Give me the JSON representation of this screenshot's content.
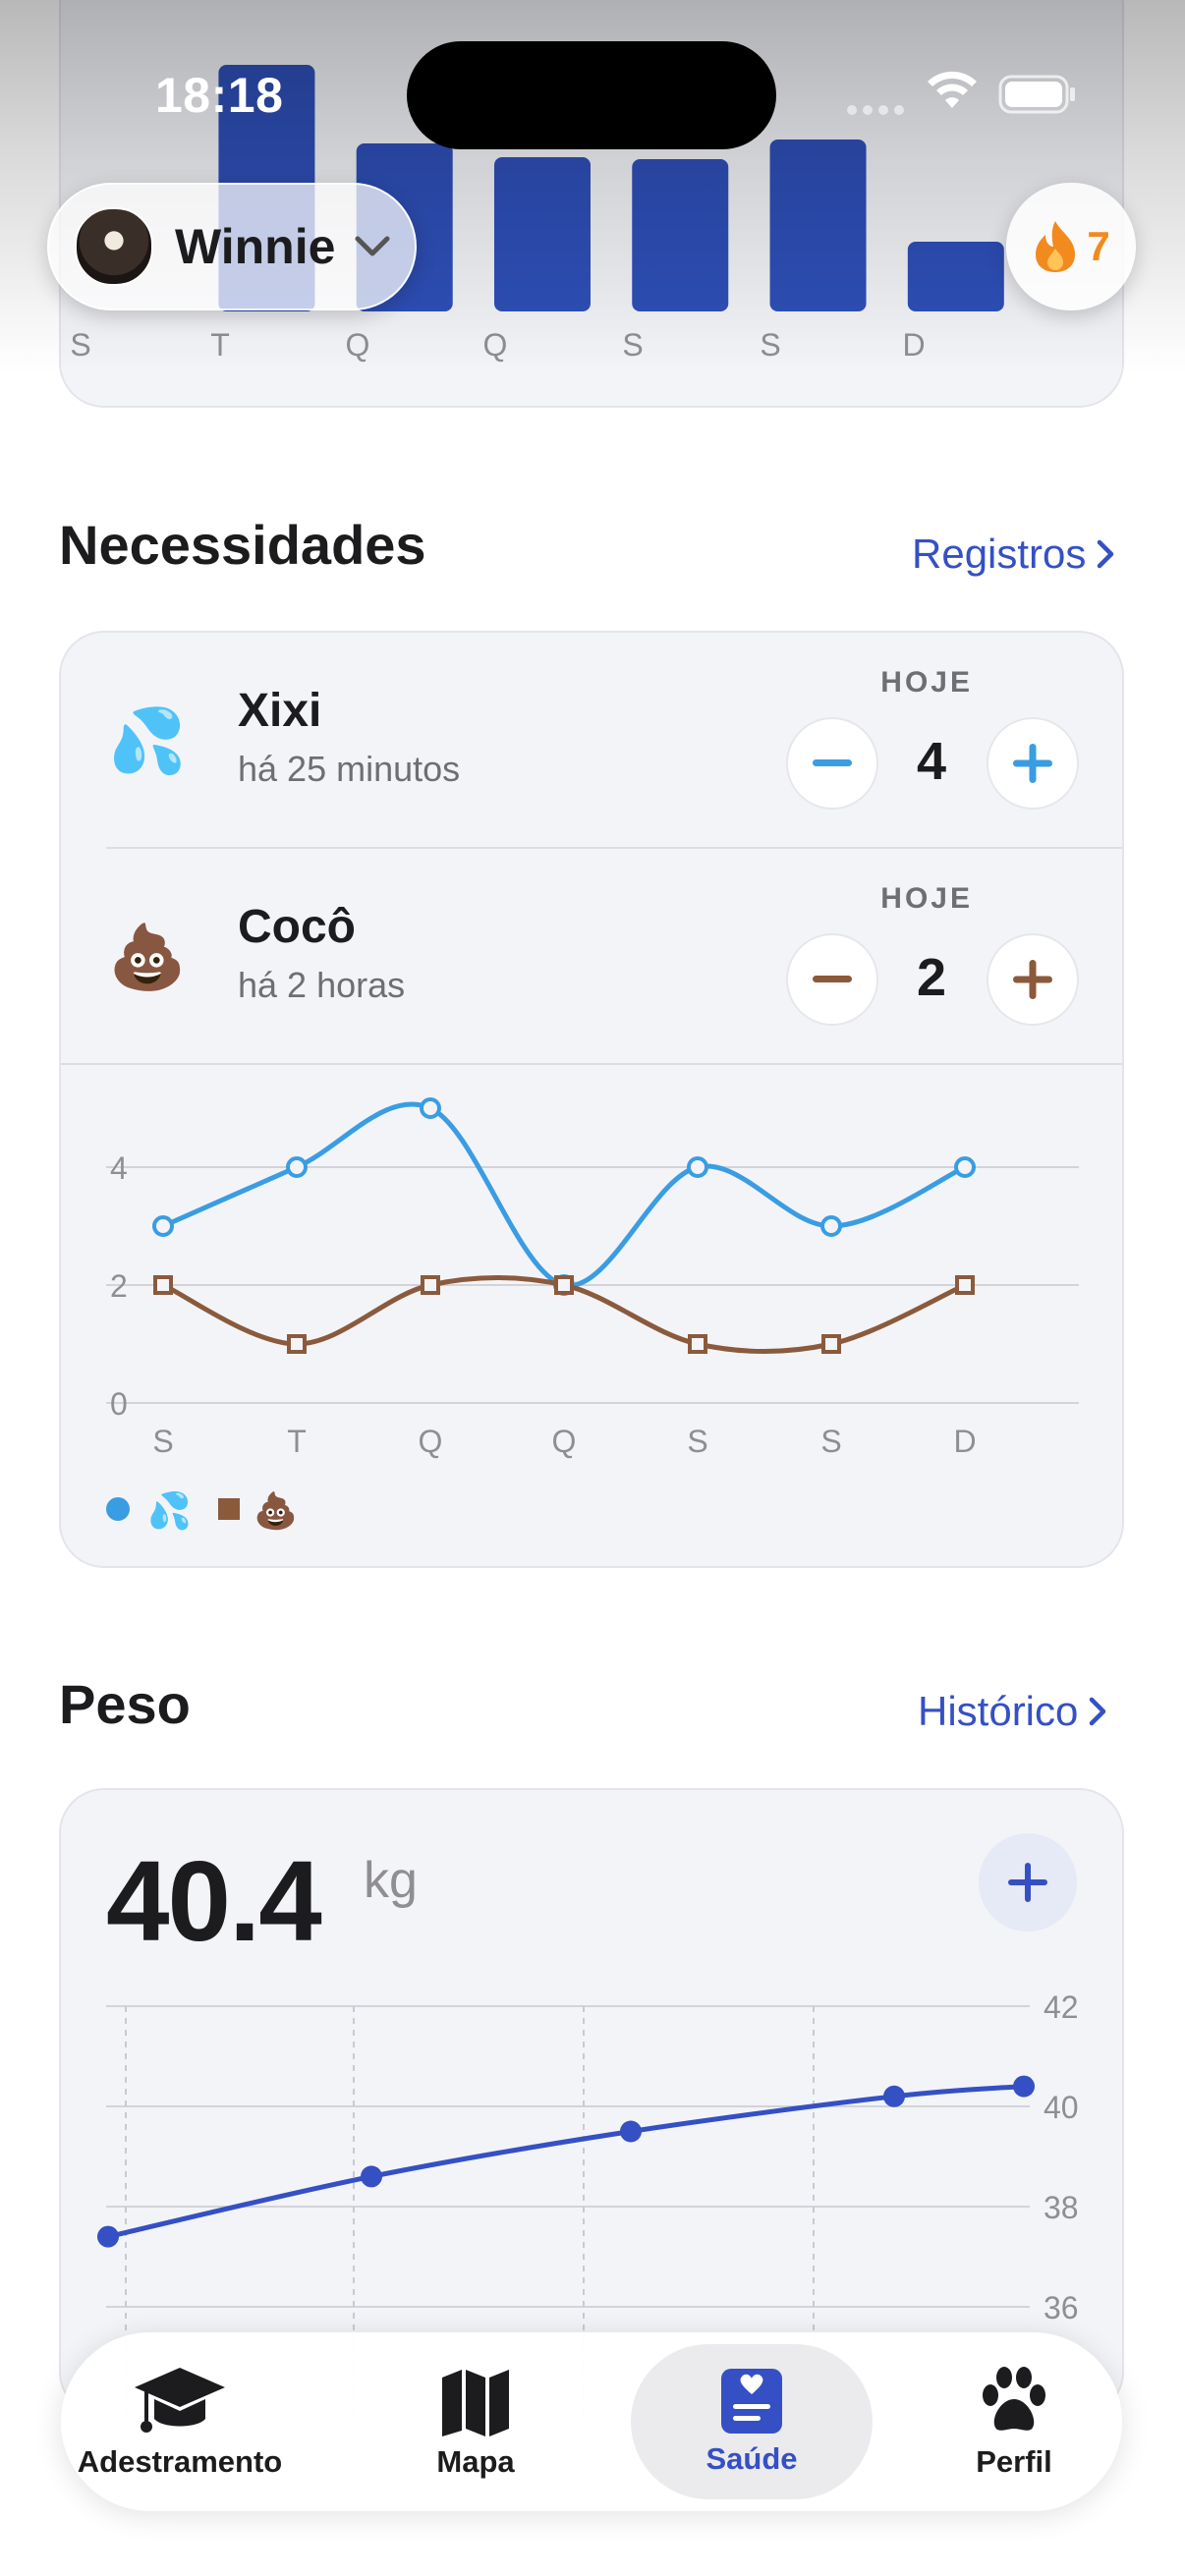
{
  "status_bar": {
    "time": "18:18"
  },
  "pet_selector": {
    "name": "Winnie"
  },
  "streak": {
    "count": "7"
  },
  "activity_week": {
    "day_labels": [
      "S",
      "T",
      "Q",
      "Q",
      "S",
      "S",
      "D"
    ],
    "bar_color": "#2e4fb8"
  },
  "needs": {
    "title": "Necessidades",
    "link_label": "Registros",
    "items": [
      {
        "emoji": "💦",
        "title": "Xixi",
        "subtitle": "há 25 minutos",
        "today_label": "HOJE",
        "count": "4",
        "color": "#3a9de3"
      },
      {
        "emoji": "💩",
        "title": "Cocô",
        "subtitle": "há 2 horas",
        "today_label": "HOJE",
        "count": "2",
        "color": "#8b5a3c"
      }
    ],
    "chart_data": {
      "type": "line",
      "categories": [
        "S",
        "T",
        "Q",
        "Q",
        "S",
        "S",
        "D"
      ],
      "series": [
        {
          "name": "💦",
          "values": [
            3,
            4,
            5,
            2,
            4,
            3,
            4
          ],
          "color": "#3a9de3",
          "marker": "circle"
        },
        {
          "name": "💩",
          "values": [
            2,
            1,
            2,
            2,
            1,
            1,
            2
          ],
          "color": "#8b5a3c",
          "marker": "square"
        }
      ],
      "ylim": [
        0,
        5
      ],
      "yticks": [
        "0",
        "2",
        "4"
      ],
      "grid": true,
      "legend": "bottom-left"
    }
  },
  "weight": {
    "title": "Peso",
    "link_label": "Histórico",
    "value": "40.4",
    "unit": "kg",
    "chart_data": {
      "type": "line",
      "values": [
        37.4,
        38.6,
        39.5,
        40.2,
        40.4
      ],
      "ylim": [
        36,
        42
      ],
      "yticks": [
        "42",
        "40",
        "38",
        "36"
      ],
      "color": "#3550c4",
      "grid": true
    }
  },
  "tab_bar": {
    "tabs": [
      {
        "label": "Adestramento",
        "icon": "graduation-cap-icon"
      },
      {
        "label": "Mapa",
        "icon": "map-icon"
      },
      {
        "label": "Saúde",
        "icon": "health-record-icon",
        "active": true
      },
      {
        "label": "Perfil",
        "icon": "paw-icon"
      }
    ]
  }
}
